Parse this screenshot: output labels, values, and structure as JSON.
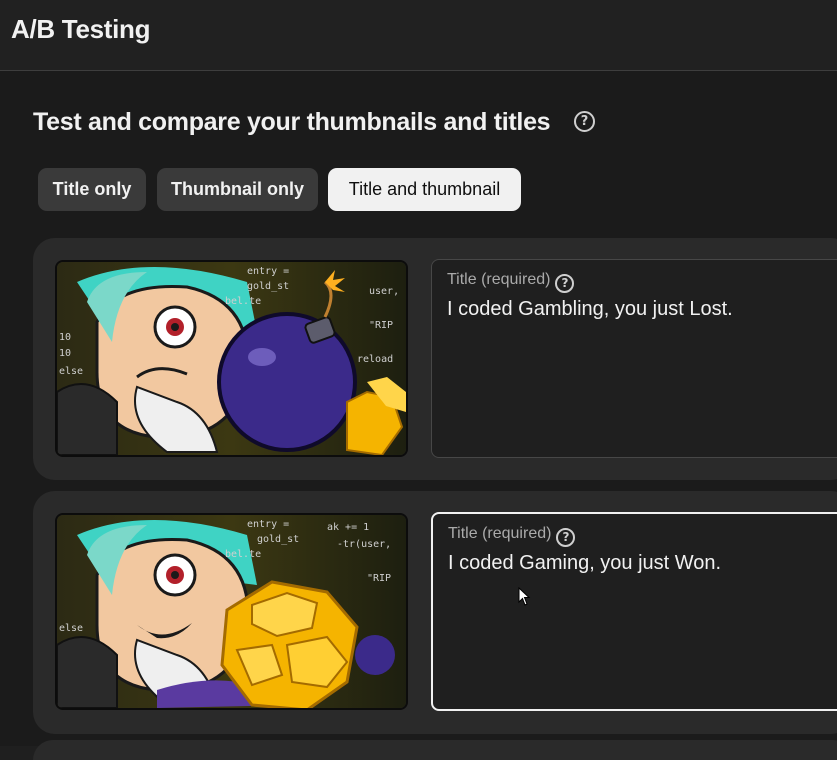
{
  "header": {
    "title": "A/B Testing"
  },
  "section": {
    "title": "Test and compare your thumbnails and titles",
    "help_icon": "help-circle-icon",
    "help_glyph": "?"
  },
  "test_types": [
    {
      "label": "Title only",
      "selected": false
    },
    {
      "label": "Thumbnail only",
      "selected": false
    },
    {
      "label": "Title and thumbnail",
      "selected": true
    }
  ],
  "variants": [
    {
      "thumbnail_code_text": [
        "entry =",
        "gold_st",
        "bel.te",
        "user,",
        "\"RIP",
        "reload",
        "10",
        "10",
        "else"
      ],
      "title_label": "Title (required)",
      "title_value": "I coded Gambling, you just Lost.",
      "focused": false
    },
    {
      "thumbnail_code_text": [
        "entry =",
        "gold_st",
        "ak += 1",
        "bel.te",
        "-tr(user,",
        "\"RIP",
        "else"
      ],
      "title_label": "Title (required)",
      "title_value": "I coded Gaming, you just Won.",
      "focused": true
    }
  ],
  "colors": {
    "background": "#1b1b1b",
    "card": "#2a2a2a",
    "chip": "#3a3a3a",
    "chip_active": "#f1f1f1",
    "bomb": "#3b2a8a",
    "gold": "#f5b400",
    "hair": "#3fd3c4"
  }
}
